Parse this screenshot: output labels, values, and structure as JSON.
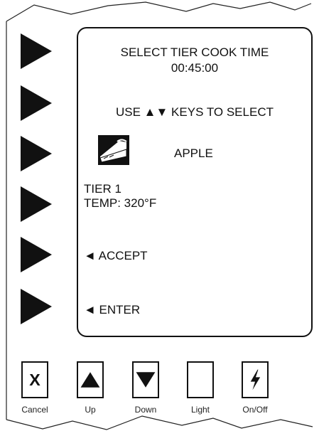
{
  "screen": {
    "title": "SELECT TIER COOK TIME",
    "time": "00:45:00",
    "instruction": "USE ▲▼ KEYS TO SELECT",
    "product": {
      "name": "APPLE",
      "icon": "pie-slice-icon"
    },
    "tier": "TIER 1",
    "temp": "TEMP: 320°F",
    "accept_label": "◄ ACCEPT",
    "enter_label": "◄ ENTER"
  },
  "side_buttons": [
    {
      "icon": "right-arrow-icon"
    },
    {
      "icon": "right-arrow-icon"
    },
    {
      "icon": "right-arrow-icon"
    },
    {
      "icon": "right-arrow-icon"
    },
    {
      "icon": "right-arrow-icon"
    },
    {
      "icon": "right-arrow-icon"
    }
  ],
  "controls": [
    {
      "label": "Cancel",
      "icon": "x-icon"
    },
    {
      "label": "Up",
      "icon": "up-triangle-icon"
    },
    {
      "label": "Down",
      "icon": "down-triangle-icon"
    },
    {
      "label": "Light",
      "icon": "blank"
    },
    {
      "label": "On/Off",
      "icon": "lightning-icon"
    }
  ],
  "colors": {
    "ink": "#111111",
    "background": "#ffffff"
  }
}
